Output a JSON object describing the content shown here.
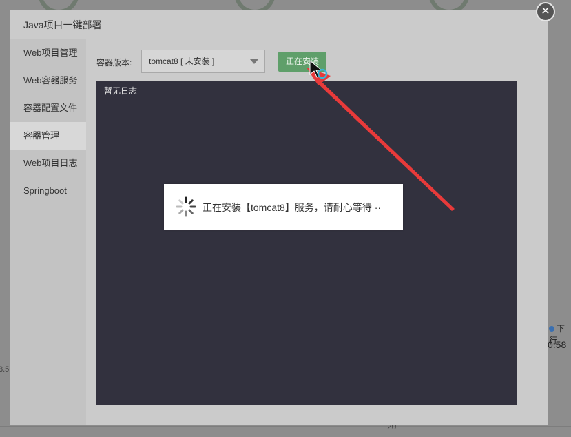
{
  "dialog": {
    "title": "Java项目一键部署",
    "close_symbol": "✕"
  },
  "sidebar": {
    "items": [
      {
        "label": "Web项目管理"
      },
      {
        "label": "Web容器服务"
      },
      {
        "label": "容器配置文件"
      },
      {
        "label": "容器管理",
        "active": true
      },
      {
        "label": "Web项目日志"
      },
      {
        "label": "Springboot"
      }
    ]
  },
  "container": {
    "version_label": "容器版本:",
    "selected_version": "tomcat8 [ 未安装 ]",
    "install_button": "正在安装"
  },
  "log": {
    "empty_text": "暂无日志"
  },
  "toast": {
    "message": "正在安装【tomcat8】服务，请耐心等待 ··"
  },
  "background": {
    "legend_label": "下行",
    "legend_value": "0.58",
    "left_number": "3.5",
    "bottom_number": "20"
  },
  "colors": {
    "install_button": "#5f9f6a",
    "log_bg": "#32313e",
    "arrow": "#e83a3a"
  }
}
